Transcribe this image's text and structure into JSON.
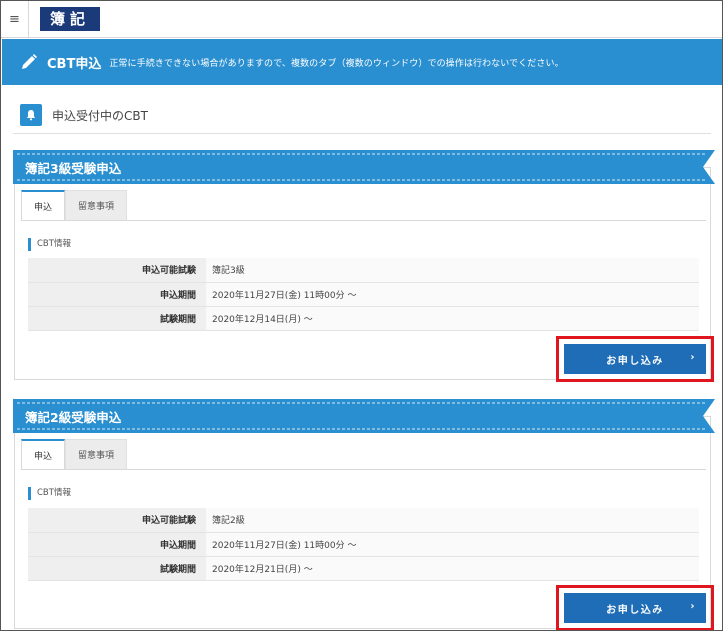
{
  "header": {
    "menu_icon": "≡",
    "logo": "簿記"
  },
  "banner": {
    "title": "CBT申込",
    "note": "正常に手続きできない場合がありますので、複数のタブ（複数のウィンドウ）での操作は行わないでください。"
  },
  "section": {
    "title": "申込受付中のCBT"
  },
  "cards": [
    {
      "ribbon_title": "簿記3級受験申込",
      "tabs": [
        "申込",
        "留意事項"
      ],
      "info_title": "CBT情報",
      "rows": [
        {
          "key": "申込可能試験",
          "value": "簿記3級"
        },
        {
          "key": "申込期間",
          "value": "2020年11月27日(金) 11時00分 ～"
        },
        {
          "key": "試験期間",
          "value": "2020年12月14日(月) ～"
        }
      ],
      "button_label": "お申し込み",
      "button_chevron": "›"
    },
    {
      "ribbon_title": "簿記2級受験申込",
      "tabs": [
        "申込",
        "留意事項"
      ],
      "info_title": "CBT情報",
      "rows": [
        {
          "key": "申込可能試験",
          "value": "簿記2級"
        },
        {
          "key": "申込期間",
          "value": "2020年11月27日(金) 11時00分 ～"
        },
        {
          "key": "試験期間",
          "value": "2020年12月21日(月) ～"
        }
      ],
      "button_label": "お申し込み",
      "button_chevron": "›"
    }
  ],
  "colors": {
    "accent": "#2a8fd0",
    "button": "#1f6db6",
    "highlight": "#e0161e",
    "logo_bg": "#1a3a7a"
  }
}
